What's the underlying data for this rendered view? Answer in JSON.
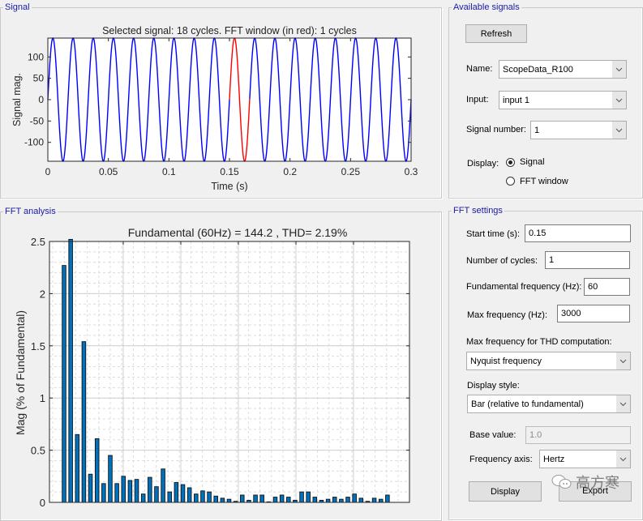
{
  "signal_panel": {
    "title": "Signal",
    "plot": {
      "title": "Selected signal: 18 cycles. FFT window (in red): 1 cycles",
      "xlabel": "Time (s)",
      "ylabel": "Signal mag.",
      "xticks": [
        "0",
        "0.05",
        "0.1",
        "0.15",
        "0.2",
        "0.25",
        "0.3"
      ],
      "yticks": [
        "100",
        "50",
        "0",
        "-50",
        "-100"
      ]
    }
  },
  "available_signals": {
    "title": "Available signals",
    "refresh_label": "Refresh",
    "name_label": "Name:",
    "name_value": "ScopeData_R100",
    "input_label": "Input:",
    "input_value": "input 1",
    "signal_number_label": "Signal number:",
    "signal_number_value": "1",
    "display_label": "Display:",
    "display_options": [
      {
        "label": "Signal",
        "selected": true
      },
      {
        "label": "FFT window",
        "selected": false
      }
    ]
  },
  "fft_panel": {
    "title": "FFT analysis"
  },
  "fft_settings": {
    "title": "FFT settings",
    "start_time_label": "Start time (s):",
    "start_time_value": "0.15",
    "num_cycles_label": "Number of cycles:",
    "num_cycles_value": "1",
    "fund_freq_label": "Fundamental frequency (Hz):",
    "fund_freq_value": "60",
    "max_freq_label": "Max frequency (Hz):",
    "max_freq_value": "3000",
    "thd_max_label": "Max frequency for THD computation:",
    "thd_max_value": "Nyquist frequency",
    "display_style_label": "Display style:",
    "display_style_value": "Bar (relative to fundamental)",
    "base_value_label": "Base value:",
    "base_value_value": "1.0",
    "freq_axis_label": "Frequency axis:",
    "freq_axis_value": "Hertz",
    "display_button": "Display",
    "export_button": "Export"
  },
  "watermark": {
    "text": "高方寒"
  },
  "chart_data": [
    {
      "type": "line",
      "title": "Selected signal: 18 cycles. FFT window (in red): 1 cycles",
      "xlabel": "Time (s)",
      "ylabel": "Signal mag.",
      "xlim": [
        0,
        0.3
      ],
      "ylim": [
        -144.2,
        144.2
      ],
      "series": [
        {
          "name": "signal",
          "color": "#0000ff",
          "function": "amplitude*sin(2*pi*frequency*t)",
          "amplitude": 144.2,
          "frequency": 60,
          "t_range": [
            0,
            0.3
          ]
        },
        {
          "name": "FFT window",
          "color": "#ff0000",
          "t_range": [
            0.15,
            0.1667
          ]
        }
      ]
    },
    {
      "type": "bar",
      "title": "Fundamental (60Hz) = 144.2 , THD= 2.19%",
      "xlabel": "",
      "ylabel": "Mag (% of Fundamental)",
      "ylim": [
        0,
        2.5
      ],
      "yticks": [
        "0",
        "0.5",
        "1",
        "1.5",
        "2",
        "2.5"
      ],
      "grid": true,
      "bar_color": "#0072bd",
      "values": [
        2.27,
        2.55,
        0.65,
        1.54,
        0.27,
        0.61,
        0.18,
        0.45,
        0.18,
        0.25,
        0.21,
        0.22,
        0.08,
        0.24,
        0.15,
        0.32,
        0.1,
        0.19,
        0.17,
        0.14,
        0.08,
        0.11,
        0.1,
        0.06,
        0.04,
        0.03,
        0.01,
        0.07,
        0.02,
        0.07,
        0.07,
        0.005,
        0.05,
        0.07,
        0.05,
        0.02,
        0.1,
        0.1,
        0.05,
        0.02,
        0.03,
        0.05,
        0.03,
        0.05,
        0.08,
        0.04,
        0.01,
        0.04,
        0.03,
        0.07
      ]
    }
  ]
}
